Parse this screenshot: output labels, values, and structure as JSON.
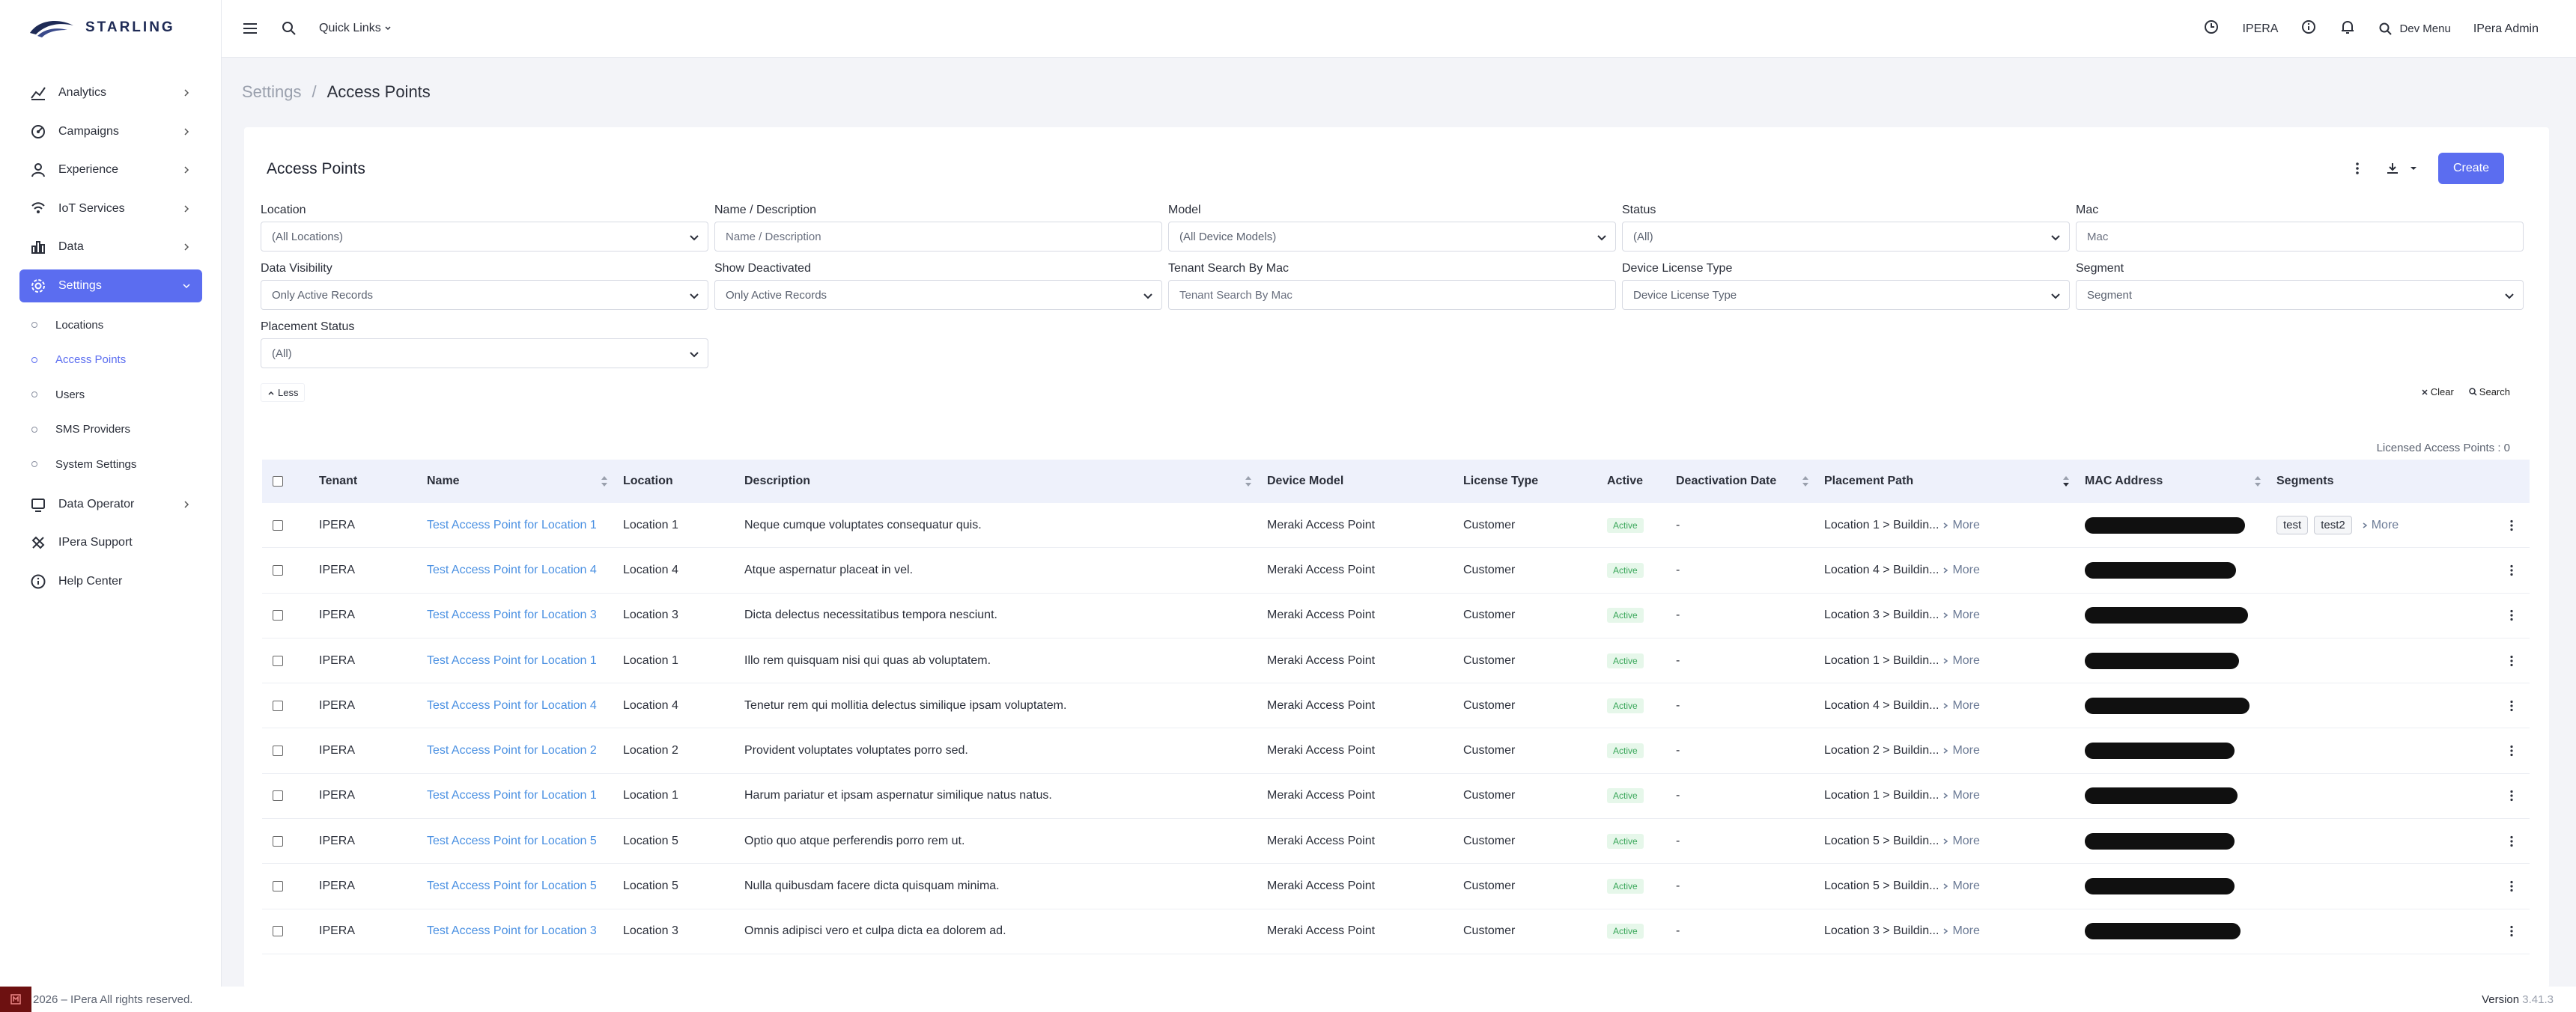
{
  "brand": {
    "name": "STARLING"
  },
  "sidebar": {
    "items": [
      {
        "label": "Analytics",
        "icon": "analytics-icon",
        "has_chevron": true
      },
      {
        "label": "Campaigns",
        "icon": "campaign-icon",
        "has_chevron": true
      },
      {
        "label": "Experience",
        "icon": "experience-icon",
        "has_chevron": true
      },
      {
        "label": "IoT Services",
        "icon": "iot-icon",
        "has_chevron": true
      },
      {
        "label": "Data",
        "icon": "data-chart-icon",
        "has_chevron": true
      },
      {
        "label": "Settings",
        "icon": "settings-icon",
        "has_chevron": true,
        "active": true
      }
    ],
    "settings_children": [
      {
        "label": "Locations"
      },
      {
        "label": "Access Points",
        "active": true
      },
      {
        "label": "Users"
      },
      {
        "label": "SMS Providers"
      },
      {
        "label": "System Settings"
      }
    ],
    "bottom_items": [
      {
        "label": "Data Operator",
        "icon": "data-operator-icon",
        "has_chevron": true
      },
      {
        "label": "IPera Support",
        "icon": "support-icon"
      },
      {
        "label": "Help Center",
        "icon": "help-icon"
      }
    ]
  },
  "topbar": {
    "quick_links": "Quick Links",
    "tenant": "IPERA",
    "dev_menu": "Dev Menu",
    "user": "IPera Admin"
  },
  "breadcrumb": {
    "parent": "Settings",
    "separator": "/",
    "current": "Access Points"
  },
  "card": {
    "title": "Access Points",
    "create_label": "Create",
    "less_label": "Less",
    "clear_label": "Clear",
    "search_label": "Search",
    "licensed_text": "Licensed Access Points : 0"
  },
  "filters": {
    "location": {
      "label": "Location",
      "value": "(All Locations)"
    },
    "name_description": {
      "label": "Name / Description",
      "placeholder": "Name / Description"
    },
    "model": {
      "label": "Model",
      "value": "(All Device Models)"
    },
    "status": {
      "label": "Status",
      "value": "(All)"
    },
    "mac": {
      "label": "Mac",
      "placeholder": "Mac"
    },
    "data_visibility": {
      "label": "Data Visibility",
      "value": "Only Active Records"
    },
    "show_deactivated": {
      "label": "Show Deactivated",
      "value": "Only Active Records"
    },
    "tenant_search": {
      "label": "Tenant Search By Mac",
      "placeholder": "Tenant Search By Mac"
    },
    "device_license": {
      "label": "Device License Type",
      "value": "Device License Type"
    },
    "segment": {
      "label": "Segment",
      "value": "Segment"
    },
    "placement_status": {
      "label": "Placement Status",
      "value": "(All)"
    }
  },
  "table": {
    "columns": [
      "Tenant",
      "Name",
      "Location",
      "Description",
      "Device Model",
      "License Type",
      "Active",
      "Deactivation Date",
      "Placement Path",
      "MAC Address",
      "Segments"
    ],
    "more_label": "More",
    "rows": [
      {
        "tenant": "IPERA",
        "name": "Test Access Point for Location 1",
        "location": "Location 1",
        "description": "Neque cumque voluptates consequatur quis.",
        "model": "Meraki Access Point",
        "license": "Customer",
        "active": "Active",
        "deactivation": "-",
        "placement": "Location 1 > Buildin...",
        "segments": [
          "test",
          "test2"
        ]
      },
      {
        "tenant": "IPERA",
        "name": "Test Access Point for Location 4",
        "location": "Location 4",
        "description": "Atque aspernatur placeat in vel.",
        "model": "Meraki Access Point",
        "license": "Customer",
        "active": "Active",
        "deactivation": "-",
        "placement": "Location 4 > Buildin...",
        "segments": []
      },
      {
        "tenant": "IPERA",
        "name": "Test Access Point for Location 3",
        "location": "Location 3",
        "description": "Dicta delectus necessitatibus tempora nesciunt.",
        "model": "Meraki Access Point",
        "license": "Customer",
        "active": "Active",
        "deactivation": "-",
        "placement": "Location 3 > Buildin...",
        "segments": []
      },
      {
        "tenant": "IPERA",
        "name": "Test Access Point for Location 1",
        "location": "Location 1",
        "description": "Illo rem quisquam nisi qui quas ab voluptatem.",
        "model": "Meraki Access Point",
        "license": "Customer",
        "active": "Active",
        "deactivation": "-",
        "placement": "Location 1 > Buildin...",
        "segments": []
      },
      {
        "tenant": "IPERA",
        "name": "Test Access Point for Location 4",
        "location": "Location 4",
        "description": "Tenetur rem qui mollitia delectus similique ipsam voluptatem.",
        "model": "Meraki Access Point",
        "license": "Customer",
        "active": "Active",
        "deactivation": "-",
        "placement": "Location 4 > Buildin...",
        "segments": []
      },
      {
        "tenant": "IPERA",
        "name": "Test Access Point for Location 2",
        "location": "Location 2",
        "description": "Provident voluptates voluptates porro sed.",
        "model": "Meraki Access Point",
        "license": "Customer",
        "active": "Active",
        "deactivation": "-",
        "placement": "Location 2 > Buildin...",
        "segments": []
      },
      {
        "tenant": "IPERA",
        "name": "Test Access Point for Location 1",
        "location": "Location 1",
        "description": "Harum pariatur et ipsam aspernatur similique natus natus.",
        "model": "Meraki Access Point",
        "license": "Customer",
        "active": "Active",
        "deactivation": "-",
        "placement": "Location 1 > Buildin...",
        "segments": []
      },
      {
        "tenant": "IPERA",
        "name": "Test Access Point for Location 5",
        "location": "Location 5",
        "description": "Optio quo atque perferendis porro rem ut.",
        "model": "Meraki Access Point",
        "license": "Customer",
        "active": "Active",
        "deactivation": "-",
        "placement": "Location 5 > Buildin...",
        "segments": []
      },
      {
        "tenant": "IPERA",
        "name": "Test Access Point for Location 5",
        "location": "Location 5",
        "description": "Nulla quibusdam facere dicta quisquam minima.",
        "model": "Meraki Access Point",
        "license": "Customer",
        "active": "Active",
        "deactivation": "-",
        "placement": "Location 5 > Buildin...",
        "segments": []
      },
      {
        "tenant": "IPERA",
        "name": "Test Access Point for Location 3",
        "location": "Location 3",
        "description": "Omnis adipisci vero et culpa dicta ea dolorem ad.",
        "model": "Meraki Access Point",
        "license": "Customer",
        "active": "Active",
        "deactivation": "-",
        "placement": "Location 3 > Buildin...",
        "segments": []
      }
    ]
  },
  "footer": {
    "copyright": "2026 – IPera All rights reserved.",
    "version_label": "Version",
    "version_value": "3.41.3"
  },
  "colors": {
    "accent": "#5b6df0",
    "link": "#4a90e2",
    "active_badge": "#3aa75a"
  }
}
